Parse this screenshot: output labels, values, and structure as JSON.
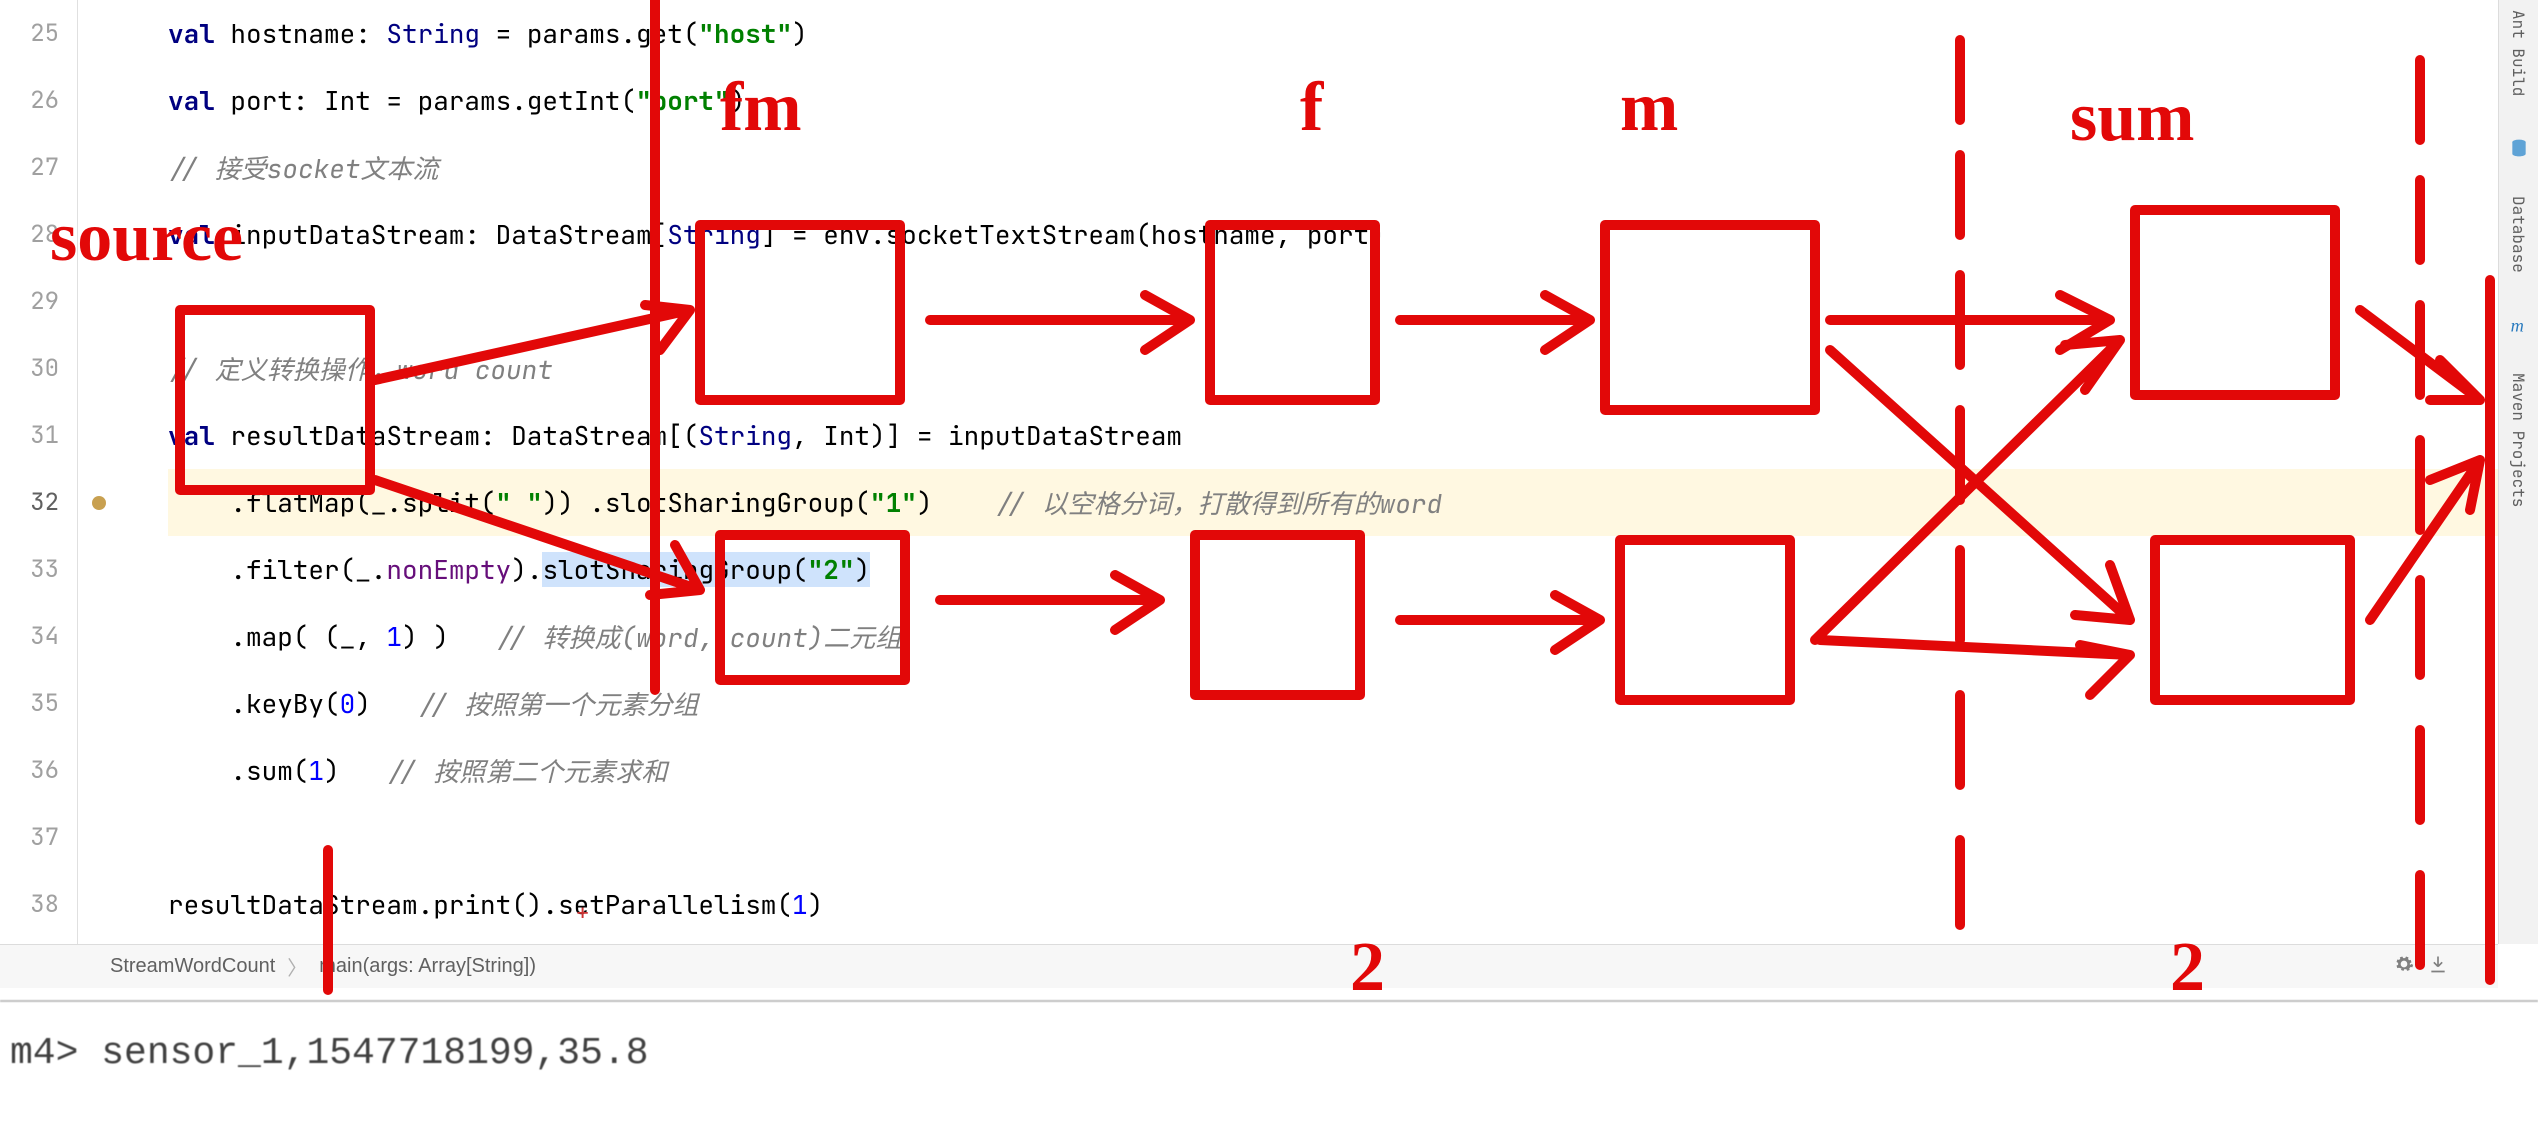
{
  "gutter": {
    "start": 25,
    "end": 38,
    "active": 32,
    "icon_line": 32
  },
  "code": {
    "25": {
      "indent": 0,
      "tokens": [
        {
          "t": "kw",
          "v": "val "
        },
        {
          "t": "plain",
          "v": "hostname: "
        },
        {
          "t": "type",
          "v": "String"
        },
        {
          "t": "plain",
          "v": " = params.get("
        },
        {
          "t": "str",
          "v": "\"host\""
        },
        {
          "t": "plain",
          "v": ")"
        }
      ]
    },
    "26": {
      "indent": 0,
      "tokens": [
        {
          "t": "kw",
          "v": "val "
        },
        {
          "t": "plain",
          "v": "port: Int = params.getInt("
        },
        {
          "t": "str",
          "v": "\"port\""
        },
        {
          "t": "plain",
          "v": ")"
        }
      ]
    },
    "27": {
      "indent": 0,
      "tokens": [
        {
          "t": "cmt",
          "v": "// 接受socket文本流"
        }
      ]
    },
    "28": {
      "indent": 0,
      "tokens": [
        {
          "t": "kw",
          "v": "val "
        },
        {
          "t": "plain",
          "v": "inputDataStream: DataStream["
        },
        {
          "t": "type",
          "v": "String"
        },
        {
          "t": "plain",
          "v": "] = env.socketTextStream(hostname, port)"
        }
      ]
    },
    "29": {
      "indent": 0,
      "tokens": []
    },
    "30": {
      "indent": 0,
      "tokens": [
        {
          "t": "cmt",
          "v": "// 定义转换操作，word count"
        }
      ]
    },
    "31": {
      "indent": 0,
      "tokens": [
        {
          "t": "kw",
          "v": "val "
        },
        {
          "t": "plain",
          "v": "resultDataStream: DataStream[("
        },
        {
          "t": "type",
          "v": "String"
        },
        {
          "t": "plain",
          "v": ", Int)] = inputDataStream"
        }
      ]
    },
    "32": {
      "indent": 1,
      "hl": true,
      "tokens": [
        {
          "t": "plain",
          "v": ".flatMap(_.split("
        },
        {
          "t": "str",
          "v": "\" \""
        },
        {
          "t": "plain",
          "v": ")) .slotSharingGroup("
        },
        {
          "t": "str",
          "v": "\"1\""
        },
        {
          "t": "plain",
          "v": ")    "
        },
        {
          "t": "cmt",
          "v": "// 以空格分词，打散得到所有的word"
        }
      ]
    },
    "33": {
      "indent": 1,
      "tokens": [
        {
          "t": "plain",
          "v": ".filter(_."
        },
        {
          "t": "ident",
          "v": "nonEmpty"
        },
        {
          "t": "plain",
          "v": ")."
        },
        {
          "t": "sel",
          "v": "slotSharingGroup("
        },
        {
          "t": "str sel",
          "v": "\"2\""
        },
        {
          "t": "sel",
          "v": ")"
        }
      ]
    },
    "34": {
      "indent": 1,
      "tokens": [
        {
          "t": "plain",
          "v": ".map( (_, "
        },
        {
          "t": "num",
          "v": "1"
        },
        {
          "t": "plain",
          "v": ") )   "
        },
        {
          "t": "cmt",
          "v": "// 转换成(word, count)二元组"
        }
      ]
    },
    "35": {
      "indent": 1,
      "tokens": [
        {
          "t": "plain",
          "v": ".keyBy("
        },
        {
          "t": "num",
          "v": "0"
        },
        {
          "t": "plain",
          "v": ")   "
        },
        {
          "t": "cmt",
          "v": "// 按照第一个元素分组"
        }
      ]
    },
    "36": {
      "indent": 1,
      "tokens": [
        {
          "t": "plain",
          "v": ".sum("
        },
        {
          "t": "num",
          "v": "1"
        },
        {
          "t": "plain",
          "v": ")   "
        },
        {
          "t": "cmt",
          "v": "// 按照第二个元素求和"
        }
      ]
    },
    "37": {
      "indent": 0,
      "tokens": []
    },
    "38": {
      "indent": 0,
      "tokens": [
        {
          "t": "plain",
          "v": "resultDataStream.print().setParallelism("
        },
        {
          "t": "num",
          "v": "1"
        },
        {
          "t": "plain",
          "v": ")"
        }
      ]
    }
  },
  "right_tabs": [
    "Ant Build",
    "Database",
    "Maven Projects"
  ],
  "breadcrumb": {
    "items": [
      "StreamWordCount",
      "main(args: Array[String])"
    ]
  },
  "terminal": {
    "line": "m4> sensor_1,1547718199,35.8"
  },
  "annotations": {
    "labels": {
      "source": "source",
      "fm": "fm",
      "f": "f",
      "m": "m",
      "sum": "sum",
      "two_a": "2",
      "two_b": "2"
    }
  }
}
